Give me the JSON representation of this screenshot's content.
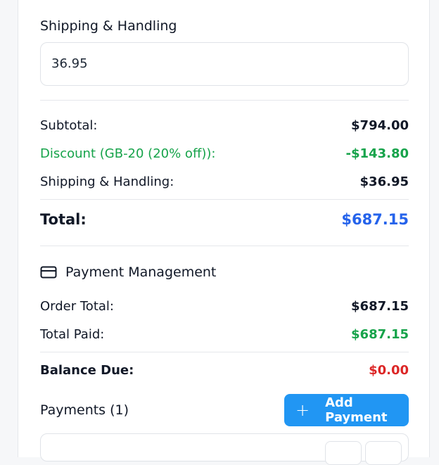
{
  "shipping_field": {
    "label": "Shipping & Handling",
    "value": "36.95"
  },
  "summary": {
    "subtotal_label": "Subtotal:",
    "subtotal_value": "$794.00",
    "discount_label": "Discount (GB-20 (20% off)):",
    "discount_value": "-$143.80",
    "shipping_label": "Shipping & Handling:",
    "shipping_value": "$36.95",
    "total_label": "Total:",
    "total_value": "$687.15"
  },
  "payment_management": {
    "title": "Payment Management",
    "icon": "credit-card-icon",
    "order_total_label": "Order Total:",
    "order_total_value": "$687.15",
    "total_paid_label": "Total Paid:",
    "total_paid_value": "$687.15",
    "balance_due_label": "Balance Due:",
    "balance_due_value": "$0.00"
  },
  "payments": {
    "label": "Payments (1)",
    "add_button_label": "Add Payment",
    "add_button_icon": "plus-icon"
  },
  "colors": {
    "accent_blue": "#2563eb",
    "button_blue": "#2196f3",
    "success_green": "#16a34a",
    "danger_red": "#dc2626"
  }
}
